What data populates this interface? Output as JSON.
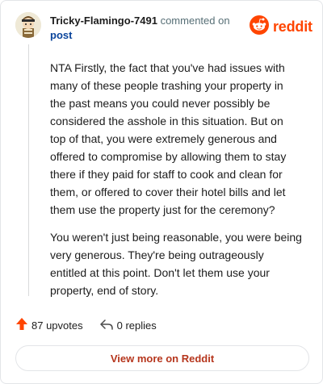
{
  "comment": {
    "username": "Tricky-Flamingo-7491",
    "action_text": "commented on",
    "post_link": "post",
    "paragraphs": [
      "NTA Firstly, the fact that you've had issues with many of these people trashing your property in the past means you could never possibly be considered the asshole in this situation. But on top of that, you were extremely generous and offered to compromise by allowing them to stay there if they paid for staff to cook and clean for them, or offered to cover their hotel bills and let them use the property just for the ceremony?",
      "You weren't just being reasonable, you were being very generous. They're being outrageously entitled at this point. Don't let them use your property, end of story."
    ]
  },
  "brand": {
    "name": "reddit",
    "color": "#ff4500"
  },
  "actions": {
    "upvotes": "87 upvotes",
    "replies": "0 replies"
  },
  "footer": {
    "view_more": "View more on Reddit"
  },
  "icons": {
    "avatar": "avatar",
    "logo": "reddit-snoo-icon",
    "upvote": "upvote-arrow-icon",
    "reply": "reply-arrow-icon"
  }
}
